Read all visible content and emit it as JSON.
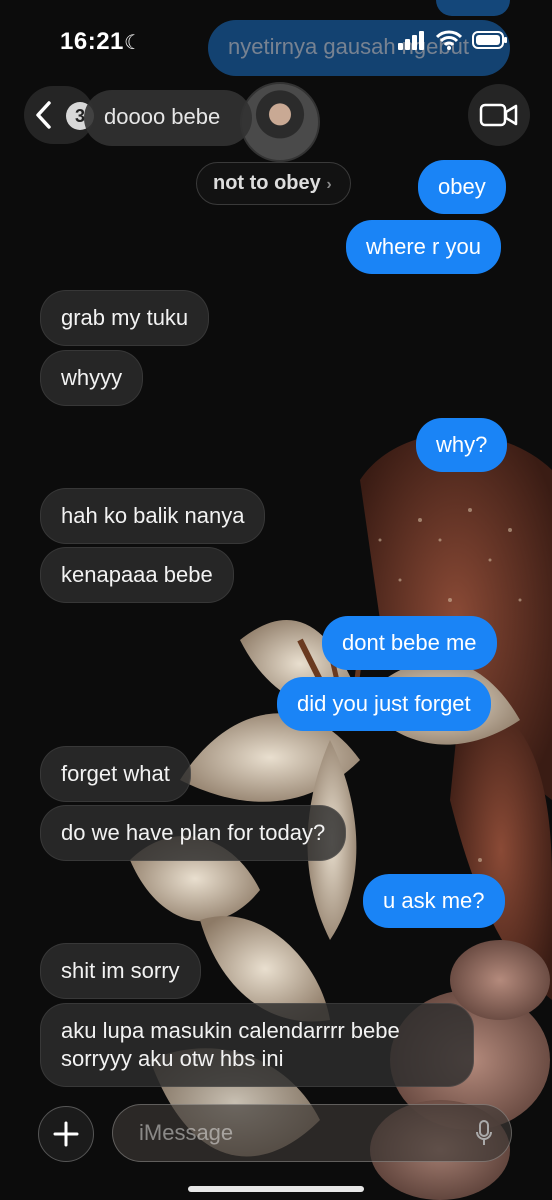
{
  "status_bar": {
    "time": "16:21",
    "icons": [
      "moon-icon",
      "signal-icon",
      "wifi-icon",
      "battery-icon"
    ]
  },
  "header": {
    "back_badge_count": "3",
    "contact_name": "not to obey",
    "icons": [
      "chevron-left-icon",
      "video-camera-icon"
    ]
  },
  "faded_messages": {
    "top_sent": "nyetirnya gausah ngebut",
    "top_recv": "doooo bebe"
  },
  "messages": [
    {
      "side": "sent",
      "text": "obey"
    },
    {
      "side": "sent",
      "text": "where r you"
    },
    {
      "side": "recv",
      "text": "grab my tuku"
    },
    {
      "side": "recv",
      "text": "whyyy"
    },
    {
      "side": "sent",
      "text": "why?"
    },
    {
      "side": "recv",
      "text": "hah ko balik nanya"
    },
    {
      "side": "recv",
      "text": "kenapaaa bebe"
    },
    {
      "side": "sent",
      "text": "dont bebe me"
    },
    {
      "side": "sent",
      "text": "did you just forget"
    },
    {
      "side": "recv",
      "text": "forget what"
    },
    {
      "side": "recv",
      "text": "do we have plan for today?"
    },
    {
      "side": "sent",
      "text": "u ask me?"
    },
    {
      "side": "recv",
      "text": "shit im sorry"
    },
    {
      "side": "recv",
      "text": "aku lupa masukin calendarrrr bebe sorryyy aku otw hbs ini"
    }
  ],
  "input": {
    "placeholder": "iMessage",
    "icons": [
      "plus-icon",
      "microphone-icon"
    ]
  },
  "colors": {
    "sent_bubble": "#1a84f6",
    "recv_bubble": "#262626",
    "background": "#0c0c0c"
  }
}
